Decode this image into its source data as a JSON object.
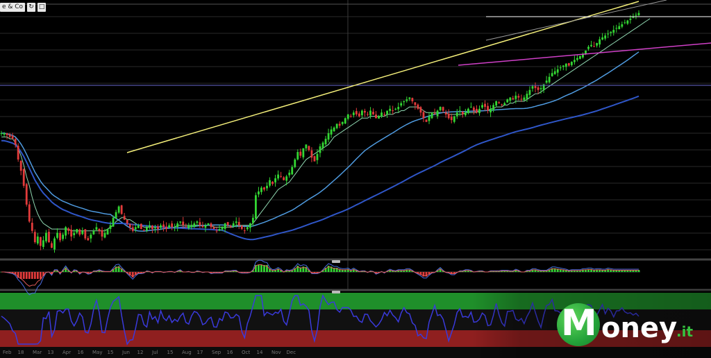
{
  "header": {
    "title": "e & Co",
    "refresh_icon": "refresh-icon"
  },
  "logo": {
    "mark": "M",
    "name": "oney",
    "tld": ".it"
  },
  "x_axis_labels": [
    "Feb",
    "18",
    "Mar",
    "13",
    "Apr",
    "16",
    "May",
    "15",
    "Jun",
    "12",
    "Jul",
    "15",
    "Aug",
    "17",
    "Sep",
    "16",
    "Oct",
    "14",
    "Nov",
    "Dec"
  ],
  "colors": {
    "up_candle": "#33d633",
    "down_candle": "#e23b3b",
    "trend_yellow": "#f4ef7a",
    "trend_magenta": "#d040c8",
    "ma_fast": "#8fd6b0",
    "ma_mid": "#4f9be0",
    "ma_slow": "#2f56c8",
    "level_line": "#6a6ad0",
    "resistance": "#ffffff",
    "osc_line": "#3a3adc"
  },
  "chart_data": [
    {
      "type": "candlestick",
      "title": "",
      "ylim": [
        0,
        100
      ],
      "n_bars": 230,
      "close": [
        80,
        80,
        79,
        78,
        77,
        74,
        66,
        60,
        52,
        42,
        33,
        28,
        22,
        25,
        20,
        23,
        27,
        22,
        19,
        24,
        27,
        23,
        26,
        30,
        28,
        25,
        27,
        29,
        26,
        28,
        24,
        23,
        26,
        28,
        30,
        28,
        25,
        27,
        29,
        31,
        35,
        38,
        41,
        37,
        34,
        32,
        30,
        28,
        30,
        31,
        29,
        28,
        30,
        31,
        29,
        30,
        29,
        31,
        30,
        29,
        31,
        30,
        30,
        32,
        33,
        31,
        30,
        31,
        31,
        32,
        33,
        31,
        30,
        31,
        32,
        30,
        29,
        28,
        29,
        30,
        32,
        31,
        30,
        32,
        33,
        31,
        29,
        28,
        30,
        32,
        35,
        47,
        49,
        51,
        50,
        52,
        55,
        53,
        56,
        58,
        57,
        55,
        57,
        59,
        62,
        66,
        70,
        68,
        72,
        74,
        71,
        67,
        65,
        69,
        73,
        75,
        77,
        80,
        82,
        83,
        85,
        84,
        86,
        88,
        90,
        89,
        91,
        90,
        89,
        92,
        91,
        90,
        92,
        90,
        88,
        89,
        91,
        90,
        92,
        93,
        92,
        93,
        94,
        96,
        97,
        98,
        99,
        97,
        95,
        93,
        91,
        88,
        86,
        89,
        91,
        90,
        92,
        94,
        92,
        90,
        88,
        87,
        89,
        91,
        92,
        90,
        91,
        93,
        94,
        92,
        91,
        93,
        95,
        94,
        92,
        93,
        95,
        97,
        96,
        95,
        96,
        98,
        99,
        98,
        100,
        99,
        98,
        99,
        101,
        103,
        105,
        104,
        103,
        104,
        106,
        108,
        110,
        112,
        113,
        114,
        115,
        116,
        117,
        116,
        118,
        119,
        120,
        121,
        122,
        124,
        126,
        127,
        126,
        128,
        130,
        131,
        132,
        133,
        134,
        135,
        136,
        137,
        138,
        139,
        140,
        141,
        142,
        143,
        144
      ],
      "series": [
        {
          "kind": "ma",
          "values": [
            78,
            78,
            78,
            77,
            77,
            75,
            72,
            68,
            63,
            57,
            52,
            46,
            41,
            37,
            34,
            32,
            31,
            30,
            29,
            29,
            29,
            29,
            29,
            29,
            29,
            28,
            28,
            28,
            28,
            28,
            28,
            28,
            28,
            28,
            28,
            28,
            28,
            28,
            29,
            30,
            31,
            33,
            34,
            35,
            35,
            34,
            34,
            33,
            32,
            31,
            31,
            30,
            30,
            30,
            30,
            30,
            30,
            30,
            30,
            30,
            30,
            30,
            30,
            31,
            31,
            31,
            31,
            31,
            31,
            31,
            31,
            31,
            31,
            31,
            31,
            31,
            30,
            30,
            30,
            30,
            30,
            30,
            30,
            30,
            31,
            31,
            31,
            31,
            31,
            31,
            32,
            34,
            36,
            38,
            40,
            42,
            44,
            46,
            48,
            50,
            51,
            52,
            53,
            54,
            56,
            58,
            60,
            62,
            64,
            66,
            67,
            68,
            69,
            70,
            71,
            72,
            73,
            74,
            76,
            78,
            79,
            80,
            81,
            82,
            83,
            84,
            85,
            86,
            87,
            88,
            88,
            88,
            89,
            89,
            89,
            89,
            89,
            89,
            90,
            90,
            90,
            91,
            91,
            92,
            92,
            93,
            94,
            94,
            94,
            94,
            93,
            92,
            91,
            91,
            91,
            91,
            91,
            91,
            91,
            91,
            90,
            90,
            90,
            90,
            90,
            90,
            91,
            91,
            91,
            91,
            91,
            92,
            92,
            92,
            92,
            93,
            93,
            94,
            94,
            94,
            95,
            95,
            96,
            96,
            97,
            97,
            97,
            97,
            98,
            99,
            100,
            101,
            101,
            102,
            103,
            104,
            105,
            106,
            107,
            108,
            109,
            110,
            111,
            112,
            113,
            114,
            115,
            116,
            117,
            118,
            119,
            120,
            121,
            122,
            123,
            124,
            125,
            126,
            127,
            128,
            129,
            130,
            131,
            132,
            133,
            134,
            135,
            136,
            137,
            138,
            139,
            140,
            141
          ]
        }
      ]
    },
    {
      "type": "histogram",
      "title": "",
      "ylim": [
        -1,
        1
      ],
      "n_bars": 230
    },
    {
      "type": "line",
      "title": "",
      "ylim": [
        0,
        100
      ],
      "n_points": 230
    }
  ]
}
